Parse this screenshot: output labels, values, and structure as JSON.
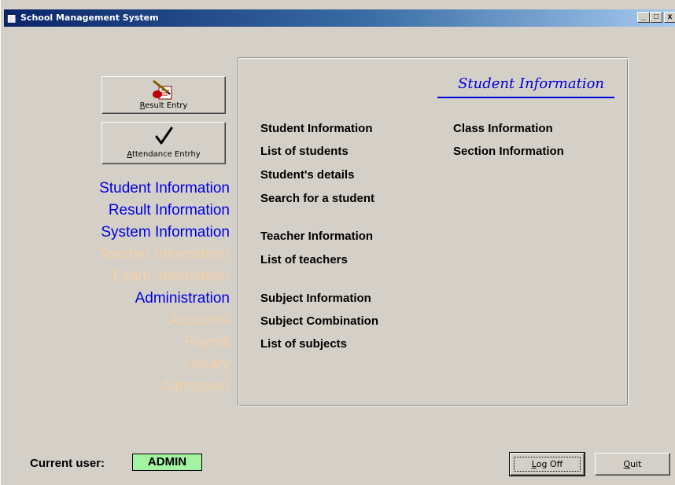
{
  "window": {
    "title": "School Management System",
    "app_icon": "book-icon",
    "controls": {
      "minimize": "_",
      "maximize": "□",
      "close": "x"
    }
  },
  "buttons": {
    "result_entry": {
      "label": "Result Entry",
      "mnemonic": "R",
      "rest": "esult Entry",
      "icon": "result-entry-icon"
    },
    "attendance_entry": {
      "label": "Attendance Entrhy",
      "mnemonic": "A",
      "rest": "ttendance Entrhy",
      "icon": "checkmark-icon"
    }
  },
  "menu": {
    "items": [
      {
        "label": "Student Information",
        "enabled": true
      },
      {
        "label": "Result Information",
        "enabled": true
      },
      {
        "label": "System Information",
        "enabled": true
      },
      {
        "label": "Teacher Information",
        "enabled": false
      },
      {
        "label": "Exam Information",
        "enabled": false
      },
      {
        "label": "Administration",
        "enabled": true
      },
      {
        "label": "Accounts",
        "enabled": false
      },
      {
        "label": "Payroll",
        "enabled": false
      },
      {
        "label": "Library",
        "enabled": false
      },
      {
        "label": "Admission",
        "enabled": false
      }
    ]
  },
  "panel": {
    "title": "Student Information",
    "col1": [
      "Student Information",
      "List of students",
      "Student's details",
      "Search for a student",
      "Teacher Information",
      "List of teachers",
      "Subject Information",
      "Subject Combination",
      "List of subjects"
    ],
    "col2": [
      "Class Information",
      "Section Information"
    ]
  },
  "status": {
    "current_user_label": "Current user:",
    "current_user_value": "ADMIN"
  },
  "footer": {
    "logoff": {
      "label": "Log Off",
      "mnemonic": "L",
      "rest": "og Off"
    },
    "quit": {
      "label": "Quit",
      "mnemonic": "Q",
      "rest": "uit"
    }
  },
  "colors": {
    "menu_active": "#0000e0",
    "menu_disabled": "#f4d0a8",
    "panel_title": "#0000e0",
    "user_badge": "#a3f3a3",
    "window_bg": "#d4d0c8"
  }
}
